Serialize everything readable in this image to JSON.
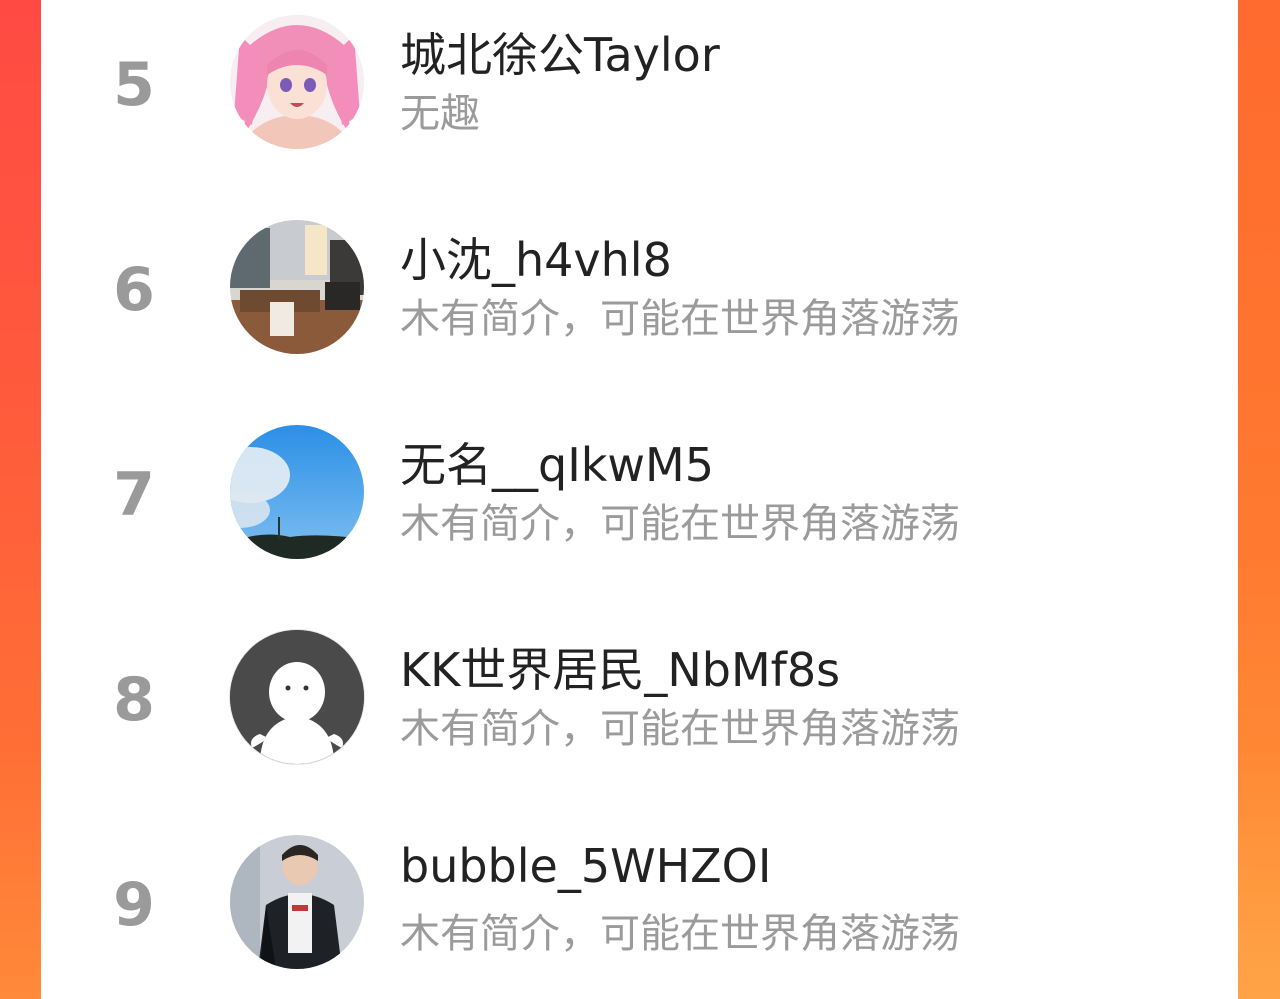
{
  "ranking": {
    "entries": [
      {
        "rank": "5",
        "name": "城北徐公Taylor",
        "bio": "无趣",
        "avatar": "anime-girl-avatar"
      },
      {
        "rank": "6",
        "name": "小沈_h4vhl8",
        "bio": "木有简介，可能在世界角落游荡",
        "avatar": "room-interior-avatar"
      },
      {
        "rank": "7",
        "name": "无名__qIkwM5",
        "bio": "木有简介，可能在世界角落游荡",
        "avatar": "blue-sky-avatar"
      },
      {
        "rank": "8",
        "name": "KK世界居民_NbMf8s",
        "bio": "木有简介，可能在世界角落游荡",
        "avatar": "default-ghost-avatar"
      },
      {
        "rank": "9",
        "name": "bubble_5WHZOI",
        "bio": "木有简介，可能在世界角落游荡",
        "avatar": "person-photo-avatar"
      }
    ]
  },
  "colors": {
    "background_left": "#ff4a44",
    "background_right": "#ff7a30",
    "card": "#ffffff",
    "rank_text": "#9a9a9a",
    "name_text": "#222222",
    "bio_text": "#9b9b9b"
  }
}
